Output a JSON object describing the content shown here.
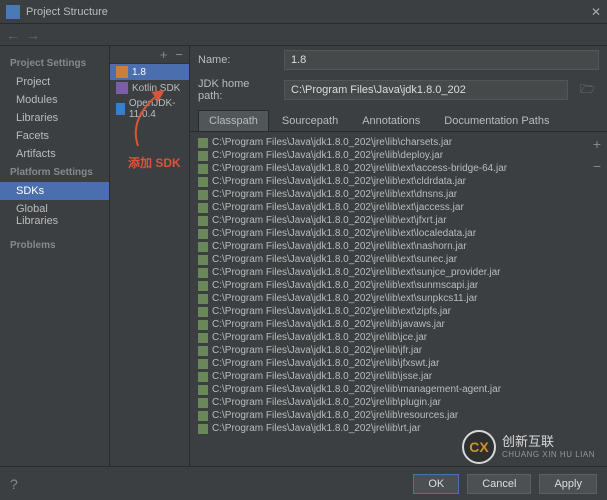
{
  "window": {
    "title": "Project Structure"
  },
  "fields": {
    "name_label": "Name:",
    "name_value": "1.8",
    "home_label": "JDK home path:",
    "home_value": "C:\\Program Files\\Java\\jdk1.8.0_202"
  },
  "left": {
    "heading1": "Project Settings",
    "items1": [
      "Project",
      "Modules",
      "Libraries",
      "Facets",
      "Artifacts"
    ],
    "heading2": "Platform Settings",
    "items2": [
      "SDKs",
      "Global Libraries"
    ],
    "heading3": "Problems"
  },
  "sdks": [
    {
      "label": "1.8",
      "icon": "java",
      "selected": true
    },
    {
      "label": "Kotlin SDK",
      "icon": "kotlin"
    },
    {
      "label": "OpenJDK-11.0.4",
      "icon": "openjdk"
    }
  ],
  "annotation": "添加 SDK",
  "tabs": [
    "Classpath",
    "Sourcepath",
    "Annotations",
    "Documentation Paths"
  ],
  "jars": [
    "C:\\Program Files\\Java\\jdk1.8.0_202\\jre\\lib\\charsets.jar",
    "C:\\Program Files\\Java\\jdk1.8.0_202\\jre\\lib\\deploy.jar",
    "C:\\Program Files\\Java\\jdk1.8.0_202\\jre\\lib\\ext\\access-bridge-64.jar",
    "C:\\Program Files\\Java\\jdk1.8.0_202\\jre\\lib\\ext\\cldrdata.jar",
    "C:\\Program Files\\Java\\jdk1.8.0_202\\jre\\lib\\ext\\dnsns.jar",
    "C:\\Program Files\\Java\\jdk1.8.0_202\\jre\\lib\\ext\\jaccess.jar",
    "C:\\Program Files\\Java\\jdk1.8.0_202\\jre\\lib\\ext\\jfxrt.jar",
    "C:\\Program Files\\Java\\jdk1.8.0_202\\jre\\lib\\ext\\localedata.jar",
    "C:\\Program Files\\Java\\jdk1.8.0_202\\jre\\lib\\ext\\nashorn.jar",
    "C:\\Program Files\\Java\\jdk1.8.0_202\\jre\\lib\\ext\\sunec.jar",
    "C:\\Program Files\\Java\\jdk1.8.0_202\\jre\\lib\\ext\\sunjce_provider.jar",
    "C:\\Program Files\\Java\\jdk1.8.0_202\\jre\\lib\\ext\\sunmscapi.jar",
    "C:\\Program Files\\Java\\jdk1.8.0_202\\jre\\lib\\ext\\sunpkcs11.jar",
    "C:\\Program Files\\Java\\jdk1.8.0_202\\jre\\lib\\ext\\zipfs.jar",
    "C:\\Program Files\\Java\\jdk1.8.0_202\\jre\\lib\\javaws.jar",
    "C:\\Program Files\\Java\\jdk1.8.0_202\\jre\\lib\\jce.jar",
    "C:\\Program Files\\Java\\jdk1.8.0_202\\jre\\lib\\jfr.jar",
    "C:\\Program Files\\Java\\jdk1.8.0_202\\jre\\lib\\jfxswt.jar",
    "C:\\Program Files\\Java\\jdk1.8.0_202\\jre\\lib\\jsse.jar",
    "C:\\Program Files\\Java\\jdk1.8.0_202\\jre\\lib\\management-agent.jar",
    "C:\\Program Files\\Java\\jdk1.8.0_202\\jre\\lib\\plugin.jar",
    "C:\\Program Files\\Java\\jdk1.8.0_202\\jre\\lib\\resources.jar",
    "C:\\Program Files\\Java\\jdk1.8.0_202\\jre\\lib\\rt.jar"
  ],
  "footer": {
    "ok": "OK",
    "cancel": "Cancel",
    "apply": "Apply"
  },
  "watermark": {
    "logo": "CX",
    "main": "创新互联",
    "sub": "CHUANG XIN HU LIAN"
  }
}
